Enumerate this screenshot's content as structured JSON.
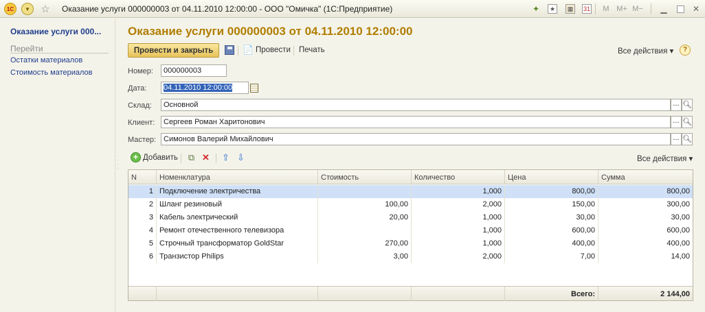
{
  "window": {
    "title": "Оказание услуги 000000003 от 04.11.2010 12:00:00 - ООО \"Омичка\"  (1С:Предприятие)",
    "logo_text": "1С",
    "m_label": "M",
    "m_plus_label": "M+",
    "m_minus_label": "M−"
  },
  "sidebar": {
    "title": "Оказание услуги 000...",
    "section": "Перейти",
    "links": [
      "Остатки материалов",
      "Стоимость материалов"
    ]
  },
  "form": {
    "title": "Оказание услуги 000000003 от 04.11.2010 12:00:00",
    "toolbar": {
      "post_close": "Провести и закрыть",
      "post": "Провести",
      "print": "Печать",
      "all_actions": "Все действия",
      "help": "?"
    },
    "number_label": "Номер:",
    "number_value": "000000003",
    "date_label": "Дата:",
    "date_value": "04.11.2010 12:00:00",
    "warehouse_label": "Склад:",
    "warehouse_value": "Основной",
    "client_label": "Клиент:",
    "client_value": "Сергеев Роман Харитонович",
    "master_label": "Мастер:",
    "master_value": "Симонов Валерий Михайлович"
  },
  "table_toolbar": {
    "add": "Добавить",
    "all_actions": "Все действия"
  },
  "table": {
    "columns": [
      "N",
      "Номенклатура",
      "Стоимость",
      "Количество",
      "Цена",
      "Сумма"
    ],
    "rows": [
      [
        "1",
        "Подключение электричества",
        "",
        "1,000",
        "800,00",
        "800,00"
      ],
      [
        "2",
        "Шланг резиновый",
        "100,00",
        "2,000",
        "150,00",
        "300,00"
      ],
      [
        "3",
        "Кабель электрический",
        "20,00",
        "1,000",
        "30,00",
        "30,00"
      ],
      [
        "4",
        "Ремонт отечественного телевизора",
        "",
        "1,000",
        "600,00",
        "600,00"
      ],
      [
        "5",
        "Строчный трансформатор GoldStar",
        "270,00",
        "1,000",
        "400,00",
        "400,00"
      ],
      [
        "6",
        "Транзистор Philips",
        "3,00",
        "2,000",
        "7,00",
        "14,00"
      ]
    ],
    "total_label": "Всего:",
    "total_value": "2 144,00"
  }
}
